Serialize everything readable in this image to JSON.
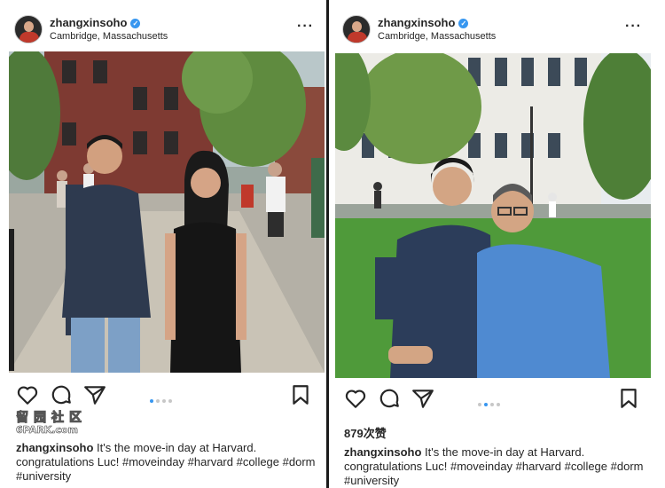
{
  "posts": [
    {
      "username": "zhangxinsoho",
      "location": "Cambridge, Massachusetts",
      "more_icon": "more-horizontal-icon",
      "likes": "",
      "caption_user": "zhangxinsoho",
      "caption_text": " It's the move-in day at Harvard. congratulations Luc!  #moveinday #harvard #college #dorm #university",
      "carousel": {
        "count": 4,
        "active_index": 0
      }
    },
    {
      "username": "zhangxinsoho",
      "location": "Cambridge, Massachusetts",
      "more_icon": "more-horizontal-icon",
      "likes": "879次赞",
      "caption_user": "zhangxinsoho",
      "caption_text": " It's the move-in day at Harvard. congratulations Luc!  #moveinday #harvard #college #dorm #university",
      "carousel": {
        "count": 4,
        "active_index": 1
      }
    }
  ],
  "watermark": {
    "chars": "留园社区",
    "url": "6PARK.com"
  },
  "icons": {
    "like": "heart-icon",
    "comment": "comment-icon",
    "share": "paper-plane-icon",
    "save": "bookmark-icon",
    "verified": "verified-badge-icon"
  },
  "colors": {
    "verified": "#3897f0",
    "text": "#262626",
    "carousel_active": "#3897f0",
    "carousel_inactive": "#c7c7c7"
  }
}
